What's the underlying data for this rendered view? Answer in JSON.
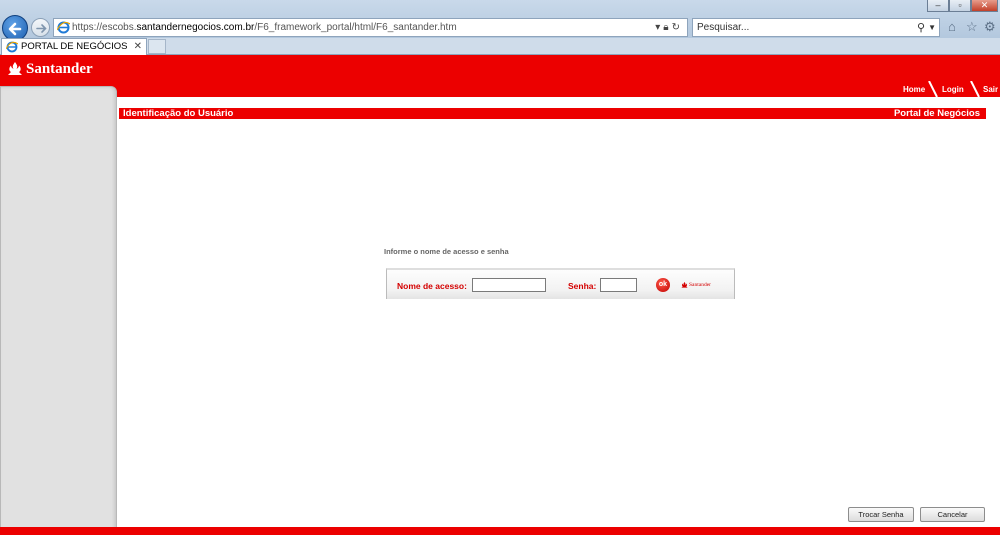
{
  "browser": {
    "url_prefix": "https://escobs.",
    "url_domain": "santandernegocios.com.br",
    "url_path": "/F6_framework_portal/html/F6_santander.htm",
    "search_placeholder": "Pesquisar...",
    "active_tab_label": "PORTAL DE NEGÓCIOS",
    "window_controls": {
      "minimize": "–",
      "maximize": "▫",
      "close": "✕"
    },
    "icons": {
      "back": "back-arrow-icon",
      "forward": "forward-arrow-icon",
      "search": "magnifier-icon",
      "home": "home-icon",
      "favorites": "star-icon",
      "tools": "gear-icon"
    }
  },
  "portal": {
    "logo_text": "Santander",
    "top_links": [
      "Home",
      "Login",
      "Sair"
    ],
    "title_left": "Identificação do Usuário",
    "title_right": "Portal de Negócios"
  },
  "login": {
    "instruction": "Informe o nome de acesso e senha",
    "username_label": "Nome de acesso:",
    "username_value": "",
    "password_label": "Senha:",
    "password_value": "",
    "ok_label": "ok",
    "mini_logo_text": "Santander"
  },
  "actions": {
    "change_password": "Trocar Senha",
    "cancel": "Cancelar"
  },
  "colors": {
    "brand_red": "#ec0000",
    "sidebar_gray": "#e1e1e1",
    "chrome_blue": "#c9d9ea"
  }
}
